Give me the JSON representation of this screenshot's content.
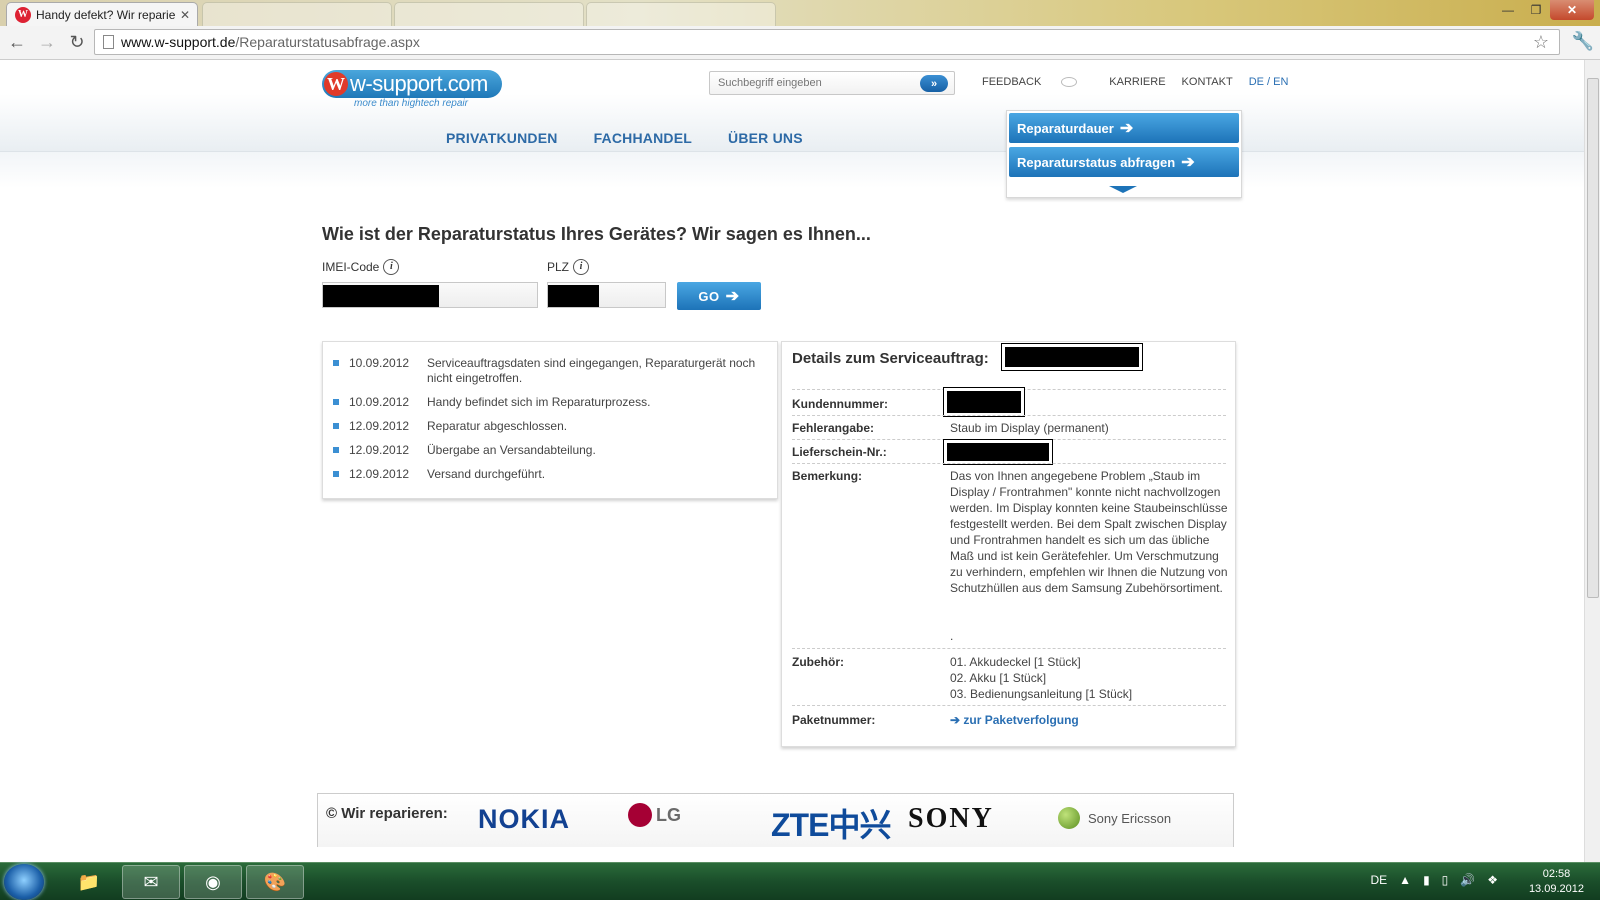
{
  "browser": {
    "tab_title": "Handy defekt? Wir reparier",
    "tab_favicon": "W",
    "url_host": "www.w-support.de",
    "url_path": "/Reparaturstatusabfrage.aspx"
  },
  "header": {
    "logo_text": "w-support.com",
    "logo_letter": "W",
    "logo_slogan": "more than hightech repair",
    "search_placeholder": "Suchbegriff eingeben",
    "search_button": "»",
    "topnav": {
      "feedback": "FEEDBACK",
      "karriere": "KARRIERE",
      "kontakt": "KONTAKT",
      "lang": "DE / EN"
    },
    "mainnav": [
      "PRIVATKUNDEN",
      "FACHHANDEL",
      "ÜBER UNS"
    ],
    "quick": {
      "reparaturdauer": "Reparaturdauer",
      "status": "Reparaturstatus abfragen"
    }
  },
  "form": {
    "headline": "Wie ist der Reparaturstatus Ihres Gerätes? Wir sagen es Ihnen...",
    "imei_label": "IMEI-Code",
    "plz_label": "PLZ",
    "info_glyph": "i",
    "go_label": "GO"
  },
  "timeline": [
    {
      "date": "10.09.2012",
      "text": "Serviceauftragsdaten sind eingegangen, Reparaturgerät noch nicht eingetroffen."
    },
    {
      "date": "10.09.2012",
      "text": "Handy befindet sich im Reparaturprozess."
    },
    {
      "date": "12.09.2012",
      "text": "Reparatur abgeschlossen."
    },
    {
      "date": "12.09.2012",
      "text": "Übergabe an Versandabteilung."
    },
    {
      "date": "12.09.2012",
      "text": "Versand durchgeführt."
    }
  ],
  "details": {
    "title": "Details zum Serviceauftrag:",
    "kundennummer_label": "Kundennummer:",
    "fehlerangabe_label": "Fehlerangabe:",
    "fehlerangabe_value": "Staub im Display (permanent)",
    "lieferschein_label": "Lieferschein-Nr.:",
    "bemerkung_label": "Bemerkung:",
    "bemerkung_value": "Das von Ihnen angegebene Problem „Staub im Display / Frontrahmen\" konnte nicht nachvollzogen werden. Im Display konnten keine Staubeinschlüsse festgestellt werden. Bei dem Spalt zwischen Display und Frontrahmen handelt es sich um das übliche Maß und ist kein Gerätefehler. Um Verschmutzung zu verhindern, empfehlen wir Ihnen die Nutzung von Schutzhüllen aus dem Samsung Zubehörsortiment.",
    "bemerkung_dot": ".",
    "zubehoer_label": "Zubehör:",
    "zubehoer": [
      "01. Akkudeckel [1 Stück]",
      "02. Akku [1 Stück]",
      "03. Bedienungsanleitung [1 Stück]"
    ],
    "paket_label": "Paketnummer:",
    "paket_link": "zur Paketverfolgung"
  },
  "footer": {
    "wir_reparieren": "© Wir reparieren:",
    "brands": {
      "nokia": "NOKIA",
      "lg": "LG",
      "zte": "ZTE中兴",
      "sony": "SONY",
      "sony_ericsson": "Sony Ericsson"
    }
  },
  "taskbar": {
    "lang": "DE",
    "time": "02:58",
    "date": "13.09.2012"
  },
  "icons": [
    "back-icon",
    "forward-icon",
    "reload-icon",
    "star-icon",
    "wrench-icon",
    "arrow-right-icon",
    "info-icon",
    "speech-bubble-icon"
  ]
}
